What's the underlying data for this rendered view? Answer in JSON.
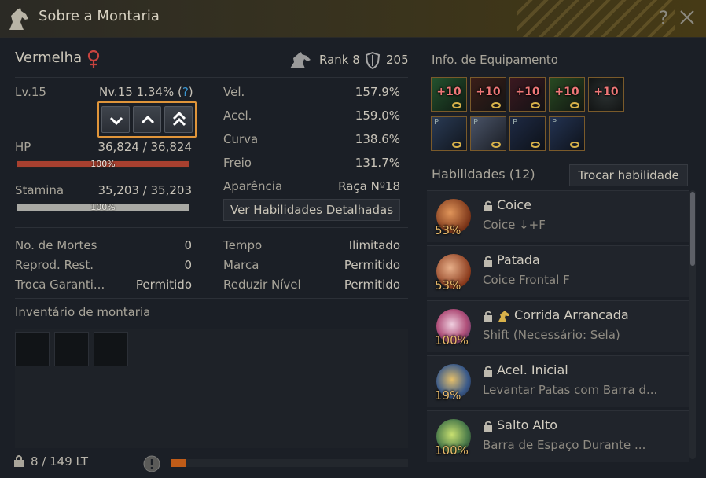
{
  "window": {
    "title": "Sobre a Montaria",
    "help_label": "?"
  },
  "horse": {
    "name": "Vermelha",
    "gender_icon": "female-icon",
    "rank": "Rank 8",
    "armor_value": "205"
  },
  "level": {
    "lv": "Lv.15",
    "nv_text": "Nv.15 1.34% (",
    "nv_q": "?",
    "nv_close": ")"
  },
  "level_buttons": [
    "chevron-down-icon",
    "chevron-up-icon",
    "double-chevron-up-icon"
  ],
  "hp": {
    "label": "HP",
    "value": "36,824 / 36,824",
    "percent_label": "100%",
    "fill": 1.0
  },
  "stamina": {
    "label": "Stamina",
    "value": "35,203 / 35,203",
    "percent_label": "100%",
    "fill": 1.0
  },
  "stats": [
    {
      "label": "Vel.",
      "value": "157.9%"
    },
    {
      "label": "Acel.",
      "value": "159.0%"
    },
    {
      "label": "Curva",
      "value": "138.6%"
    },
    {
      "label": "Freio",
      "value": "131.7%"
    },
    {
      "label": "Aparência",
      "value": "Raça Nº18"
    }
  ],
  "detail_button": "Ver Habilidades Detalhadas",
  "info_left": [
    {
      "label": "No. de Mortes",
      "value": "0"
    },
    {
      "label": "Reprod. Rest.",
      "value": "0"
    },
    {
      "label": "Troca Garanti...",
      "value": "Permitido"
    }
  ],
  "info_right": [
    {
      "label": "Tempo",
      "value": "Ilimitado"
    },
    {
      "label": "Marca",
      "value": "Permitido"
    },
    {
      "label": "Reduzir Nível",
      "value": "Permitido"
    }
  ],
  "inventory": {
    "title": "Inventário de montaria",
    "weight": "8 / 149 LT",
    "weight_fill": 0.06
  },
  "equipment": {
    "title": "Info. de Equipamento",
    "row1": [
      "+10",
      "+10",
      "+10",
      "+10",
      "+10"
    ],
    "row2_marker": "P"
  },
  "skills": {
    "title": "Habilidades (12)",
    "change_button": "Trocar habilidade",
    "items": [
      {
        "name": "Coice",
        "command": "Coice ↓+F",
        "percent": "53%",
        "mount_icon": false
      },
      {
        "name": "Patada",
        "command": "Coice Frontal F",
        "percent": "53%",
        "mount_icon": false
      },
      {
        "name": "Corrida Arrancada",
        "command": "Shift (Necessário: Sela)",
        "percent": "100%",
        "mount_icon": true
      },
      {
        "name": "Acel. Inicial",
        "command": "Levantar Patas com Barra d...",
        "percent": "19%",
        "mount_icon": false
      },
      {
        "name": "Salto Alto",
        "command": "Barra de Espaço Durante ...",
        "percent": "100%",
        "mount_icon": false
      }
    ]
  },
  "colors": {
    "hp_bar": "#a8402f",
    "stamina_bar": "#a9a9a4",
    "accent": "#e0953a",
    "gender": "#c8433f"
  }
}
